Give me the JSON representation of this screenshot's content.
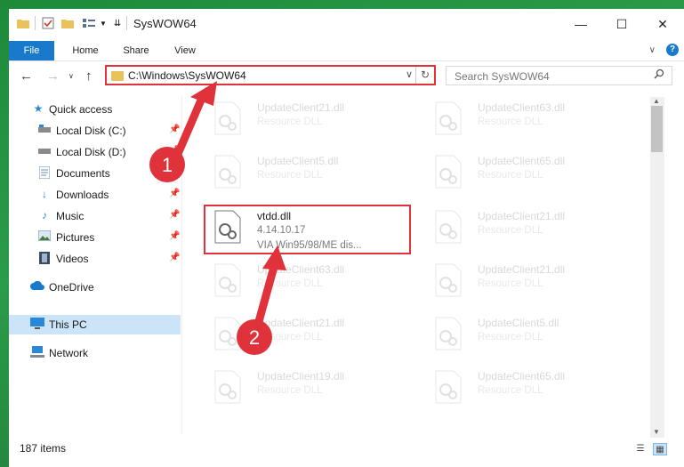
{
  "window": {
    "title": "SysWOW64"
  },
  "title_controls": {
    "minimize": "—",
    "maximize": "☐",
    "close": "✕"
  },
  "ribbon": {
    "tabs": [
      "File",
      "Home",
      "Share",
      "View"
    ]
  },
  "address": {
    "path": "C:\\Windows\\SysWOW64"
  },
  "search": {
    "placeholder": "Search SysWOW64"
  },
  "sidebar": {
    "items": [
      {
        "label": "Quick access",
        "icon": "star-icon",
        "pinned": false
      },
      {
        "label": "Local Disk (C:)",
        "icon": "drive-icon",
        "pinned": true
      },
      {
        "label": "Local Disk (D:)",
        "icon": "drive-icon",
        "pinned": true
      },
      {
        "label": "Documents",
        "icon": "documents-icon",
        "pinned": true
      },
      {
        "label": "Downloads",
        "icon": "download-arrow-icon",
        "pinned": true
      },
      {
        "label": "Music",
        "icon": "music-note-icon",
        "pinned": true
      },
      {
        "label": "Pictures",
        "icon": "pictures-icon",
        "pinned": true
      },
      {
        "label": "Videos",
        "icon": "film-icon",
        "pinned": true
      },
      {
        "label": "OneDrive",
        "icon": "cloud-icon",
        "pinned": false
      },
      {
        "label": "This PC",
        "icon": "computer-icon",
        "pinned": false
      },
      {
        "label": "Network",
        "icon": "network-icon",
        "pinned": false
      }
    ]
  },
  "files": [
    {
      "name": "UpdateClient21.dll",
      "type": "Resource DLL",
      "extra": ""
    },
    {
      "name": "UpdateClient63.dll",
      "type": "Resource DLL",
      "extra": ""
    },
    {
      "name": "UpdateClient5.dll",
      "type": "Resource DLL",
      "extra": ""
    },
    {
      "name": "UpdateClient65.dll",
      "type": "Resource DLL",
      "extra": ""
    },
    {
      "name": "vtdd.dll",
      "type": "4.14.10.17",
      "extra": "VIA Win95/98/ME dis..."
    },
    {
      "name": "UpdateClient21.dll",
      "type": "Resource DLL",
      "extra": ""
    },
    {
      "name": "UpdateClient63.dll",
      "type": "Resource DLL",
      "extra": ""
    },
    {
      "name": "UpdateClient21.dll",
      "type": "Resource DLL",
      "extra": ""
    },
    {
      "name": "UpdateClient21.dll",
      "type": "Resource DLL",
      "extra": ""
    },
    {
      "name": "UpdateClient5.dll",
      "type": "Resource DLL",
      "extra": ""
    },
    {
      "name": "UpdateClient19.dll",
      "type": "Resource DLL",
      "extra": ""
    },
    {
      "name": "UpdateClient65.dll",
      "type": "Resource DLL",
      "extra": ""
    }
  ],
  "status": {
    "item_count": "187 items"
  },
  "annotations": {
    "step1": "1",
    "step2": "2"
  },
  "colors": {
    "accent": "#1979ca",
    "highlight": "#e0323a",
    "selected": "#cce4f7"
  }
}
